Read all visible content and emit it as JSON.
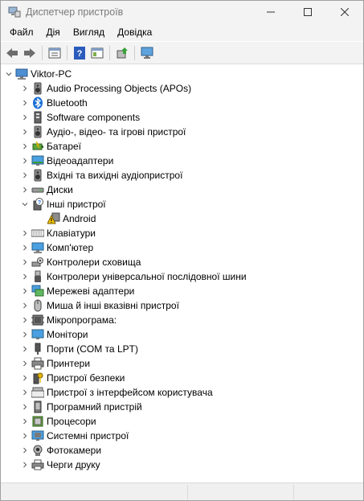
{
  "window": {
    "title": "Диспетчер пристроїв"
  },
  "menu": [
    "Файл",
    "Дія",
    "Вигляд",
    "Довідка"
  ],
  "toolbar": [
    "back-icon",
    "forward-icon",
    "properties-icon",
    "help-icon",
    "view-icon",
    "update-driver-icon",
    "monitor-scan-icon"
  ],
  "tree": {
    "root": "Viktor-PC",
    "categories": [
      {
        "label": "Audio Processing Objects (APOs)",
        "icon": "speaker-icon"
      },
      {
        "label": "Bluetooth",
        "icon": "bluetooth-icon"
      },
      {
        "label": "Software components",
        "icon": "software-component-icon"
      },
      {
        "label": "Аудіо-, відео- та ігрові пристрої",
        "icon": "speaker-icon"
      },
      {
        "label": "Батареї",
        "icon": "battery-icon"
      },
      {
        "label": "Відеоадаптери",
        "icon": "display-adapter-icon"
      },
      {
        "label": "Вхідні та вихідні аудіопристрої",
        "icon": "speaker-icon"
      },
      {
        "label": "Диски",
        "icon": "disk-icon"
      },
      {
        "label": "Інші пристрої",
        "icon": "unknown-device-icon",
        "expanded": true,
        "children": [
          {
            "label": "Android",
            "icon": "warning-device-icon"
          }
        ]
      },
      {
        "label": "Клавіатури",
        "icon": "keyboard-icon"
      },
      {
        "label": "Комп'ютер",
        "icon": "computer-icon"
      },
      {
        "label": "Контролери сховища",
        "icon": "storage-controller-icon"
      },
      {
        "label": "Контролери універсальної послідовної шини",
        "icon": "usb-icon"
      },
      {
        "label": "Мережеві адаптери",
        "icon": "network-icon"
      },
      {
        "label": "Миша й інші вказівні пристрої",
        "icon": "mouse-icon"
      },
      {
        "label": "Мікропрограма:",
        "icon": "firmware-icon"
      },
      {
        "label": "Монітори",
        "icon": "monitor-icon"
      },
      {
        "label": "Порти (COM та LPT)",
        "icon": "port-icon"
      },
      {
        "label": "Принтери",
        "icon": "printer-icon"
      },
      {
        "label": "Пристрої безпеки",
        "icon": "security-key-icon"
      },
      {
        "label": "Пристрої з інтерфейсом користувача",
        "icon": "hid-icon"
      },
      {
        "label": "Програмний пристрій",
        "icon": "software-device-icon"
      },
      {
        "label": "Процесори",
        "icon": "processor-icon"
      },
      {
        "label": "Системні пристрої",
        "icon": "system-device-icon"
      },
      {
        "label": "Фотокамери",
        "icon": "camera-icon"
      },
      {
        "label": "Черги друку",
        "icon": "print-queue-icon"
      }
    ]
  }
}
